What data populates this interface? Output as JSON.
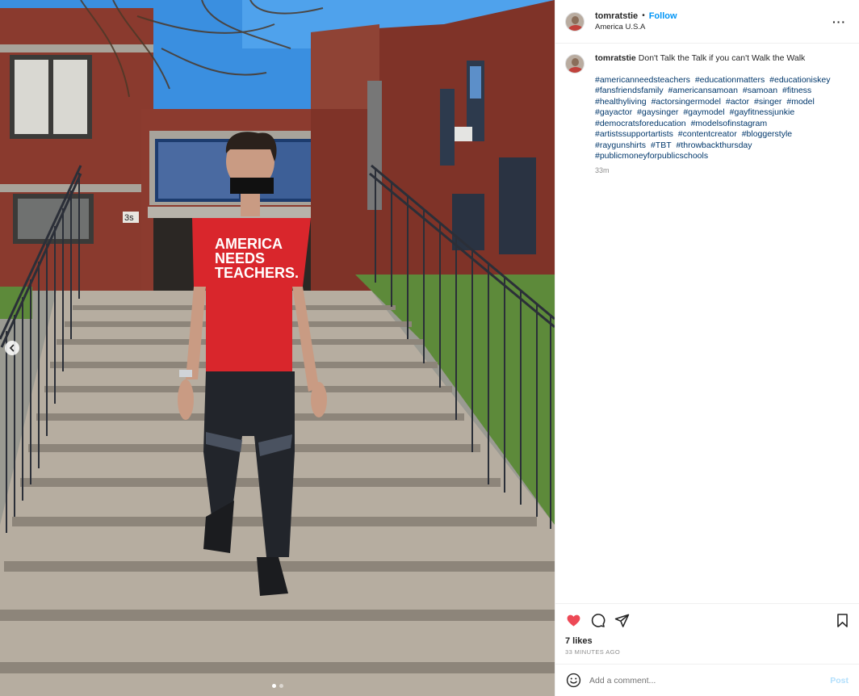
{
  "post": {
    "username": "tomratstie",
    "separator": "•",
    "follow_label": "Follow",
    "location": "America U.S.A",
    "more_label": "···",
    "shirt_text_line1": "AMERICA",
    "shirt_text_line2": "NEEDS",
    "shirt_text_line3": "TEACHERS.",
    "building_number": "3s"
  },
  "caption": {
    "username": "tomratstie",
    "text": "Don't Talk the Talk if you can't Walk the Walk",
    "hashtags": [
      "#americanneedsteachers",
      "#educationmatters",
      "#educationiskey",
      "#fansfriendsfamily",
      "#americansamoan",
      "#samoan",
      "#fitness",
      "#healthyliving",
      "#actorsingermodel",
      "#actor",
      "#singer",
      "#model",
      "#gayactor",
      "#gaysinger",
      "#gaymodel",
      "#gayfitnessjunkie",
      "#democratsforeducation",
      "#modelsofinstagram",
      "#artistssupportartists",
      "#contentcreator",
      "#bloggerstyle",
      "#raygunshirts",
      "#TBT",
      "#throwbackthursday",
      "#publicmoneyforpublicschools"
    ],
    "time": "33m"
  },
  "engagement": {
    "likes": "7 likes",
    "time_ago": "33 MINUTES AGO"
  },
  "comment": {
    "placeholder": "Add a comment...",
    "post_label": "Post"
  },
  "colors": {
    "like_red": "#ed4956",
    "link_blue": "#0095f6",
    "hashtag_navy": "#00376b",
    "post_disabled": "#b2dffc"
  },
  "icons": {
    "like": "heart-icon",
    "comment": "comment-icon",
    "share": "share-icon",
    "save": "bookmark-icon",
    "emoji": "emoji-icon",
    "carousel_prev": "chevron-left-icon"
  }
}
